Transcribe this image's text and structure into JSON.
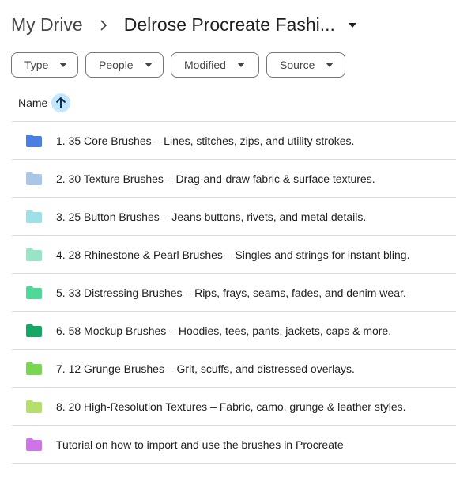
{
  "breadcrumb": {
    "root": "My Drive",
    "current": "Delrose Procreate Fashi..."
  },
  "filters": [
    {
      "label": "Type"
    },
    {
      "label": "People"
    },
    {
      "label": "Modified"
    },
    {
      "label": "Source"
    }
  ],
  "list_header": {
    "name_label": "Name",
    "sort": "ascending"
  },
  "files": [
    {
      "name": "1. 35 Core Brushes – Lines, stitches, zips, and utility strokes.",
      "icon": "folder-icon",
      "color": "#4a7fe0"
    },
    {
      "name": "2. 30 Texture Brushes – Drag-and-draw fabric & surface textures.",
      "icon": "folder-icon",
      "color": "#a9c6e6"
    },
    {
      "name": "3. 25 Button Brushes – Jeans buttons, rivets, and metal details.",
      "icon": "folder-icon",
      "color": "#9ee0e8"
    },
    {
      "name": "4. 28 Rhinestone & Pearl Brushes – Singles and strings for instant bling.",
      "icon": "folder-icon",
      "color": "#98e4c4"
    },
    {
      "name": "5. 33 Distressing Brushes – Rips, frays, seams, fades, and denim wear.",
      "icon": "folder-icon",
      "color": "#4fd897"
    },
    {
      "name": "6. 58 Mockup Brushes – Hoodies, tees, pants, jackets, caps & more.",
      "icon": "folder-icon",
      "color": "#16a765"
    },
    {
      "name": "7. 12 Grunge Brushes – Grit, scuffs, and distressed overlays.",
      "icon": "folder-icon",
      "color": "#7ad651"
    },
    {
      "name": "8. 20 High-Resolution Textures – Fabric, camo, grunge & leather styles.",
      "icon": "folder-icon",
      "color": "#b6de6d"
    },
    {
      "name": "Tutorial on how to import and use the brushes in Procreate",
      "icon": "folder-icon",
      "color": "#cd74e6"
    }
  ]
}
